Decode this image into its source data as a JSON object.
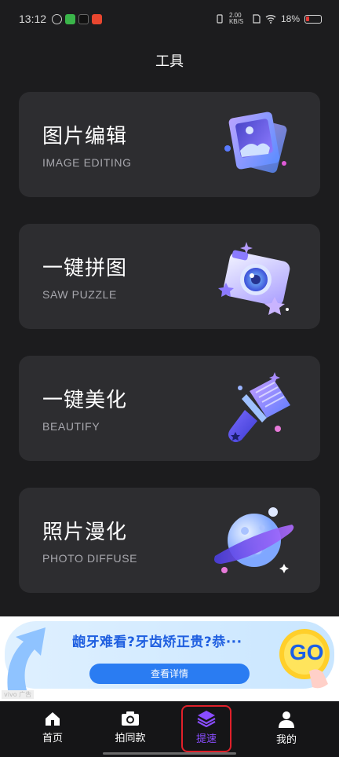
{
  "status_bar": {
    "time": "13:12",
    "speed": "2.00 KB/S",
    "battery": "18%"
  },
  "header": {
    "title": "工具"
  },
  "tools": [
    {
      "title": "图片编辑",
      "subtitle": "IMAGE EDITING",
      "icon": "photo-stack-icon"
    },
    {
      "title": "一键拼图",
      "subtitle": "SAW PUZZLE",
      "icon": "camera-icon"
    },
    {
      "title": "一键美化",
      "subtitle": "BEAUTIFY",
      "icon": "brush-icon"
    },
    {
      "title": "照片漫化",
      "subtitle": "PHOTO DIFFUSE",
      "icon": "planet-icon"
    }
  ],
  "ad": {
    "headline": "龅牙难看?牙齿矫正贵?恭···",
    "cta": "查看详情",
    "go_text": "GO",
    "label": "vivo 广告"
  },
  "tabbar": {
    "items": [
      {
        "label": "首页",
        "icon": "home-icon"
      },
      {
        "label": "拍同款",
        "icon": "camera-icon"
      },
      {
        "label": "提速",
        "icon": "layers-icon"
      },
      {
        "label": "我的",
        "icon": "user-icon"
      }
    ],
    "active_index": 2
  },
  "colors": {
    "background": "#1c1c1e",
    "card": "#2d2d30",
    "accent": "#8a4dff",
    "highlight_border": "#e0202a"
  }
}
